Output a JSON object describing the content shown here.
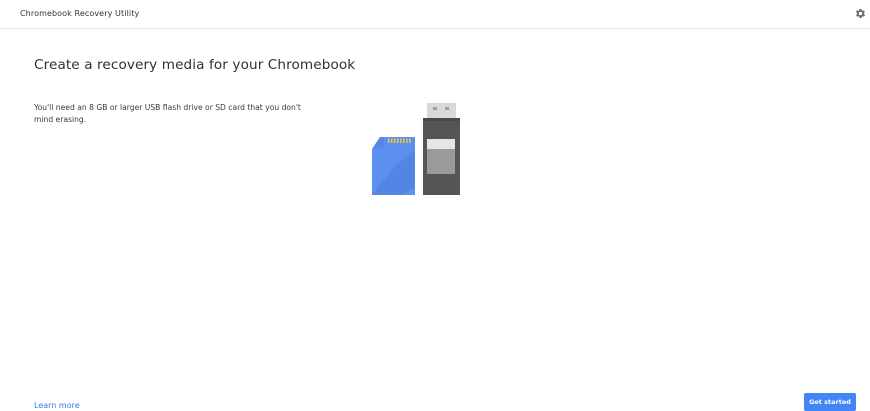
{
  "window": {
    "title": "Chromebook Recovery Utility",
    "settings_icon": "gear-icon"
  },
  "main": {
    "heading": "Create a recovery media for your Chromebook",
    "description": "You'll need an 8 GB or larger USB flash drive or SD card that you don't mind erasing.",
    "illustration": {
      "icons": [
        "sd-card-icon",
        "usb-drive-icon"
      ],
      "colors": {
        "sd_card": "#5b8ff0",
        "sd_card_shadow": "#4a7ad4",
        "sd_contacts": "#e8c640",
        "usb_body": "#555555",
        "usb_label": "#9a9a9a",
        "usb_connector": "#d9d9d9"
      }
    }
  },
  "footer": {
    "learn_more_label": "Learn more",
    "get_started_label": "Get started"
  },
  "colors": {
    "accent": "#4285f4",
    "link": "#3b78e7",
    "divider": "#e3e3e3"
  }
}
